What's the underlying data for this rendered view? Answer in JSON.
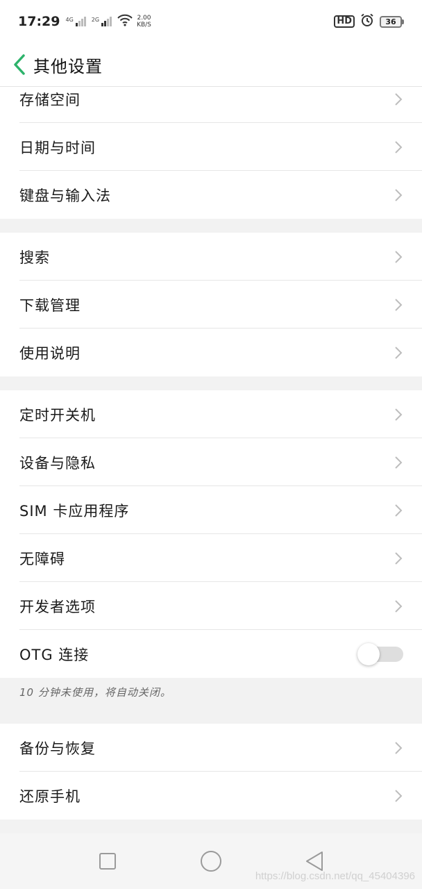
{
  "status_bar": {
    "time": "17:29",
    "sim1": "4G",
    "sim2": "2G",
    "speed_value": "2.00",
    "speed_unit": "KB/S",
    "hd": "HD",
    "battery": "36",
    "icons": [
      "signal-icon",
      "wifi-icon",
      "hd-icon",
      "alarm-icon",
      "battery-icon"
    ]
  },
  "header": {
    "title": "其他设置",
    "back_icon": "chevron-left-icon"
  },
  "groups": [
    {
      "items": [
        "存储空间",
        "日期与时间",
        "键盘与输入法"
      ]
    },
    {
      "items": [
        "搜索",
        "下载管理",
        "使用说明"
      ]
    },
    {
      "items": [
        "定时开关机",
        "设备与隐私",
        "SIM 卡应用程序",
        "无障碍",
        "开发者选项"
      ]
    },
    {
      "items": [
        "备份与恢复",
        "还原手机"
      ]
    }
  ],
  "otg": {
    "label": "OTG 连接",
    "enabled": false,
    "hint": "10 分钟未使用，将自动关闭。"
  },
  "nav_bar": {
    "icons": [
      "recent-apps-icon",
      "home-icon",
      "back-icon"
    ]
  },
  "watermark": "https://blog.csdn.net/qq_45404396",
  "colors": {
    "accent": "#2db36b",
    "background": "#f2f2f2"
  }
}
